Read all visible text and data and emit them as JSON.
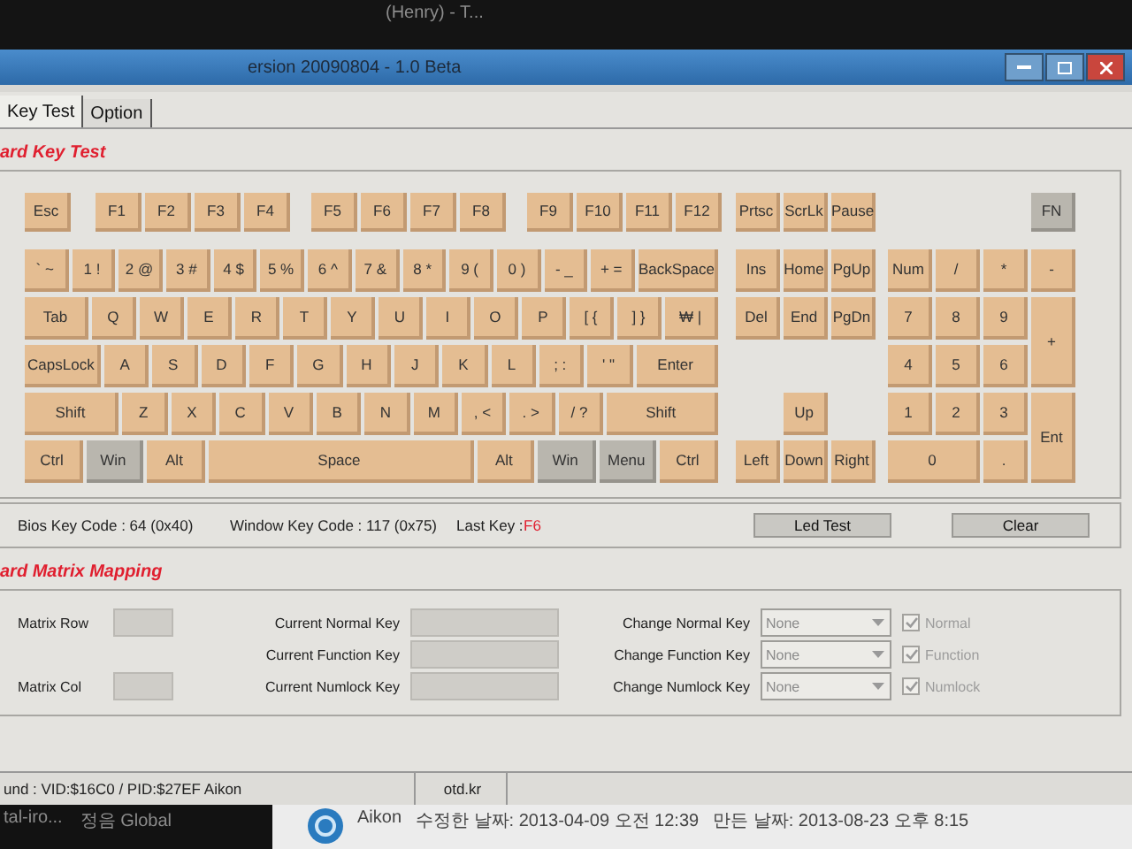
{
  "background_window": {
    "title": "(Henry) - T..."
  },
  "window": {
    "title": "ersion 20090804 - 1.0 Beta"
  },
  "tabs": [
    {
      "label": "Key Test",
      "selected": true
    },
    {
      "label": "Option",
      "selected": false
    }
  ],
  "key_test": {
    "heading": "ard Key Test",
    "main_rows": [
      [
        {
          "label": "Esc",
          "dimmed": false
        },
        {
          "label": "F1",
          "dimmed": false
        },
        {
          "label": "F2",
          "dimmed": false
        },
        {
          "label": "F3",
          "dimmed": false
        },
        {
          "label": "F4",
          "dimmed": false
        },
        {
          "label": "F5",
          "dimmed": false
        },
        {
          "label": "F6",
          "dimmed": false
        },
        {
          "label": "F7",
          "dimmed": false
        },
        {
          "label": "F8",
          "dimmed": false
        },
        {
          "label": "F9",
          "dimmed": false
        },
        {
          "label": "F10",
          "dimmed": false
        },
        {
          "label": "F11",
          "dimmed": false
        },
        {
          "label": "F12",
          "dimmed": false
        }
      ],
      [
        {
          "label": "` ~",
          "dimmed": false
        },
        {
          "label": "1 !",
          "dimmed": false
        },
        {
          "label": "2 @",
          "dimmed": false
        },
        {
          "label": "3 #",
          "dimmed": false
        },
        {
          "label": "4 $",
          "dimmed": false
        },
        {
          "label": "5 %",
          "dimmed": false
        },
        {
          "label": "6 ^",
          "dimmed": false
        },
        {
          "label": "7 &",
          "dimmed": false
        },
        {
          "label": "8 *",
          "dimmed": false
        },
        {
          "label": "9 (",
          "dimmed": false
        },
        {
          "label": "0 )",
          "dimmed": false
        },
        {
          "label": "- _",
          "dimmed": false
        },
        {
          "label": "+ =",
          "dimmed": false
        },
        {
          "label": "BackSpace",
          "dimmed": false
        }
      ],
      [
        {
          "label": "Tab",
          "dimmed": false
        },
        {
          "label": "Q",
          "dimmed": false
        },
        {
          "label": "W",
          "dimmed": false
        },
        {
          "label": "E",
          "dimmed": false
        },
        {
          "label": "R",
          "dimmed": false
        },
        {
          "label": "T",
          "dimmed": false
        },
        {
          "label": "Y",
          "dimmed": false
        },
        {
          "label": "U",
          "dimmed": false
        },
        {
          "label": "I",
          "dimmed": false
        },
        {
          "label": "O",
          "dimmed": false
        },
        {
          "label": "P",
          "dimmed": false
        },
        {
          "label": "[ {",
          "dimmed": false
        },
        {
          "label": "] }",
          "dimmed": false
        },
        {
          "label": "₩ |",
          "dimmed": false
        }
      ],
      [
        {
          "label": "CapsLock",
          "dimmed": false
        },
        {
          "label": "A",
          "dimmed": false
        },
        {
          "label": "S",
          "dimmed": false
        },
        {
          "label": "D",
          "dimmed": false
        },
        {
          "label": "F",
          "dimmed": false
        },
        {
          "label": "G",
          "dimmed": false
        },
        {
          "label": "H",
          "dimmed": false
        },
        {
          "label": "J",
          "dimmed": false
        },
        {
          "label": "K",
          "dimmed": false
        },
        {
          "label": "L",
          "dimmed": false
        },
        {
          "label": "; :",
          "dimmed": false
        },
        {
          "label": "' \"",
          "dimmed": false
        },
        {
          "label": "Enter",
          "dimmed": false
        }
      ],
      [
        {
          "label": "Shift",
          "dimmed": false
        },
        {
          "label": "Z",
          "dimmed": false
        },
        {
          "label": "X",
          "dimmed": false
        },
        {
          "label": "C",
          "dimmed": false
        },
        {
          "label": "V",
          "dimmed": false
        },
        {
          "label": "B",
          "dimmed": false
        },
        {
          "label": "N",
          "dimmed": false
        },
        {
          "label": "M",
          "dimmed": false
        },
        {
          "label": ", <",
          "dimmed": false
        },
        {
          "label": ". >",
          "dimmed": false
        },
        {
          "label": "/ ?",
          "dimmed": false
        },
        {
          "label": "Shift",
          "dimmed": false
        }
      ],
      [
        {
          "label": "Ctrl",
          "dimmed": false
        },
        {
          "label": "Win",
          "dimmed": true
        },
        {
          "label": "Alt",
          "dimmed": false
        },
        {
          "label": "Space",
          "dimmed": false
        },
        {
          "label": "Alt",
          "dimmed": false
        },
        {
          "label": "Win",
          "dimmed": true
        },
        {
          "label": "Menu",
          "dimmed": true
        },
        {
          "label": "Ctrl",
          "dimmed": false
        }
      ]
    ],
    "nav_keys": [
      {
        "label": "Prtsc",
        "dimmed": false
      },
      {
        "label": "ScrLk",
        "dimmed": false
      },
      {
        "label": "Pause",
        "dimmed": false
      },
      {
        "label": "Ins",
        "dimmed": false
      },
      {
        "label": "Home",
        "dimmed": false
      },
      {
        "label": "PgUp",
        "dimmed": false
      },
      {
        "label": "Del",
        "dimmed": false
      },
      {
        "label": "End",
        "dimmed": false
      },
      {
        "label": "PgDn",
        "dimmed": false
      },
      {
        "label": "Up",
        "dimmed": false
      },
      {
        "label": "Left",
        "dimmed": false
      },
      {
        "label": "Down",
        "dimmed": false
      },
      {
        "label": "Right",
        "dimmed": false
      }
    ],
    "numpad_keys": [
      {
        "label": "FN",
        "dimmed": true
      },
      {
        "label": "Num",
        "dimmed": false
      },
      {
        "label": "/",
        "dimmed": false
      },
      {
        "label": "*",
        "dimmed": false
      },
      {
        "label": "-",
        "dimmed": false
      },
      {
        "label": "7",
        "dimmed": false
      },
      {
        "label": "8",
        "dimmed": false
      },
      {
        "label": "9",
        "dimmed": false
      },
      {
        "label": "+",
        "dimmed": false
      },
      {
        "label": "4",
        "dimmed": false
      },
      {
        "label": "5",
        "dimmed": false
      },
      {
        "label": "6",
        "dimmed": false
      },
      {
        "label": "1",
        "dimmed": false
      },
      {
        "label": "2",
        "dimmed": false
      },
      {
        "label": "3",
        "dimmed": false
      },
      {
        "label": "Ent",
        "dimmed": false
      },
      {
        "label": "0",
        "dimmed": false
      },
      {
        "label": ".",
        "dimmed": false
      }
    ]
  },
  "key_info": {
    "bios_key_code": "Bios Key Code : 64 (0x40)",
    "window_key_code": "Window Key Code : 117 (0x75)",
    "last_key_label": "Last Key :",
    "last_key": "F6",
    "buttons": [
      "Led Test",
      "Clear"
    ]
  },
  "matrix": {
    "heading": "ard Matrix Mapping",
    "matrix_row_label": "Matrix Row",
    "matrix_col_label": "Matrix Col",
    "rows": [
      {
        "current_label": "Current Normal Key",
        "change_label": "Change Normal Key",
        "select_value": "None",
        "check_label": "Normal",
        "checked": true
      },
      {
        "current_label": "Current Function Key",
        "change_label": "Change Function Key",
        "select_value": "None",
        "check_label": "Function",
        "checked": true
      },
      {
        "current_label": "Current Numlock Key",
        "change_label": "Change Numlock Key",
        "select_value": "None",
        "check_label": "Numlock",
        "checked": true
      }
    ]
  },
  "status_bar": [
    "und : VID:$16C0 / PID:$27EF Aikon",
    "otd.kr"
  ],
  "taskbar_left": [
    "tal-iro...",
    "정음 Global"
  ],
  "file_details": {
    "name": "Aikon",
    "modified": "수정한 날짜: 2013-04-09 오전 12:39",
    "created": "만든 날짜: 2013-08-23 오후 8:15"
  }
}
